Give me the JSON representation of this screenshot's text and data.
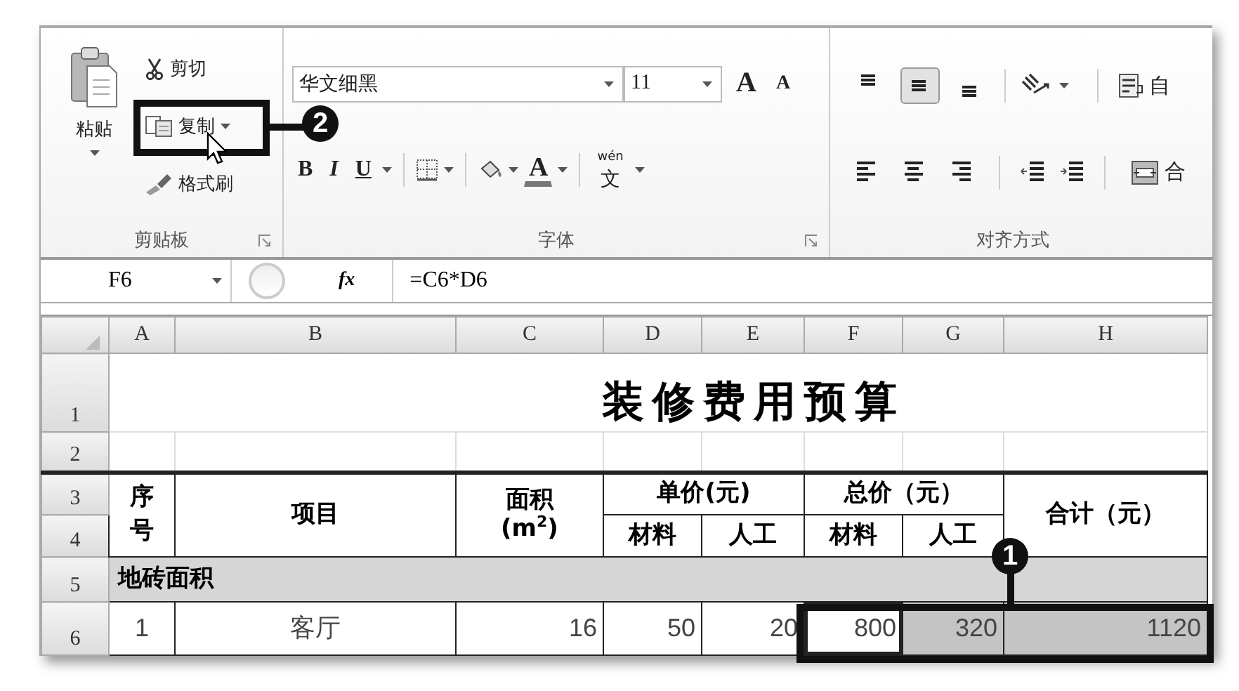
{
  "ribbon": {
    "clipboard": {
      "paste": "粘贴",
      "cut": "剪切",
      "copy": "复制",
      "format_painter": "格式刷",
      "label": "剪贴板"
    },
    "font": {
      "font_name": "华文细黑",
      "font_size": "11",
      "grow": "A",
      "shrink": "A",
      "bold": "B",
      "italic": "I",
      "underline": "U",
      "font_color": "A",
      "phonetic_top": "wén",
      "phonetic_bottom": "文",
      "label": "字体"
    },
    "alignment": {
      "vertical": [
        {
          "kind": "top",
          "selected": false
        },
        {
          "kind": "middle",
          "selected": true
        },
        {
          "kind": "bottom",
          "selected": false
        }
      ],
      "wrap": "自",
      "merge": "合",
      "label": "对齐方式"
    }
  },
  "formula_bar": {
    "name_box": "F6",
    "fx": "fx",
    "formula": "=C6*D6"
  },
  "sheet": {
    "columns": [
      "A",
      "B",
      "C",
      "D",
      "E",
      "F",
      "G",
      "H"
    ],
    "rows": [
      {
        "header": "1",
        "kind": "title",
        "cells": [
          {
            "text": "装修费用预算",
            "kind": "full",
            "selected": false
          }
        ]
      },
      {
        "header": "2",
        "kind": "blank"
      },
      {
        "header": "3",
        "kind": "head",
        "cells": [
          {
            "text": "序号",
            "kind": "tall",
            "selected": false
          },
          {
            "text": "项目",
            "kind": "tall",
            "selected": false
          },
          {
            "text": "面积\n(m$^{2}$)",
            "kind": "tall",
            "selected": false
          },
          {
            "text": "单价(元)",
            "kind": "wide",
            "selected": false
          },
          {
            "text": "总价（元）",
            "kind": "wide",
            "selected": false
          },
          {
            "text": "合计（元）",
            "kind": "tall",
            "selected": false
          }
        ]
      },
      {
        "header": "4",
        "kind": "head",
        "cells": [
          {
            "text": "材料",
            "kind": "cell",
            "selected": false
          },
          {
            "text": "人工",
            "kind": "cell",
            "selected": false
          },
          {
            "text": "材料",
            "kind": "cell",
            "selected": false
          },
          {
            "text": "人工",
            "kind": "cell",
            "selected": false
          }
        ]
      },
      {
        "header": "5",
        "kind": "section",
        "cells": [
          {
            "text": "地砖面积",
            "kind": "full",
            "selected": false
          }
        ]
      },
      {
        "header": "6",
        "kind": "data",
        "cells": [
          {
            "text": "1",
            "kind": "cell",
            "selected": false
          },
          {
            "text": "客厅",
            "kind": "cell",
            "selected": false
          },
          {
            "text": "16",
            "kind": "cell",
            "selected": false
          },
          {
            "text": "50",
            "kind": "cell",
            "selected": false
          },
          {
            "text": "20",
            "kind": "cell",
            "selected": false
          },
          {
            "text": "800",
            "kind": "active",
            "selected": false
          },
          {
            "text": "320",
            "kind": "cell",
            "selected": true
          },
          {
            "text": "1120",
            "kind": "cell",
            "selected": true
          }
        ]
      }
    ]
  },
  "callouts": [
    {
      "number": "2"
    },
    {
      "number": "1"
    }
  ]
}
